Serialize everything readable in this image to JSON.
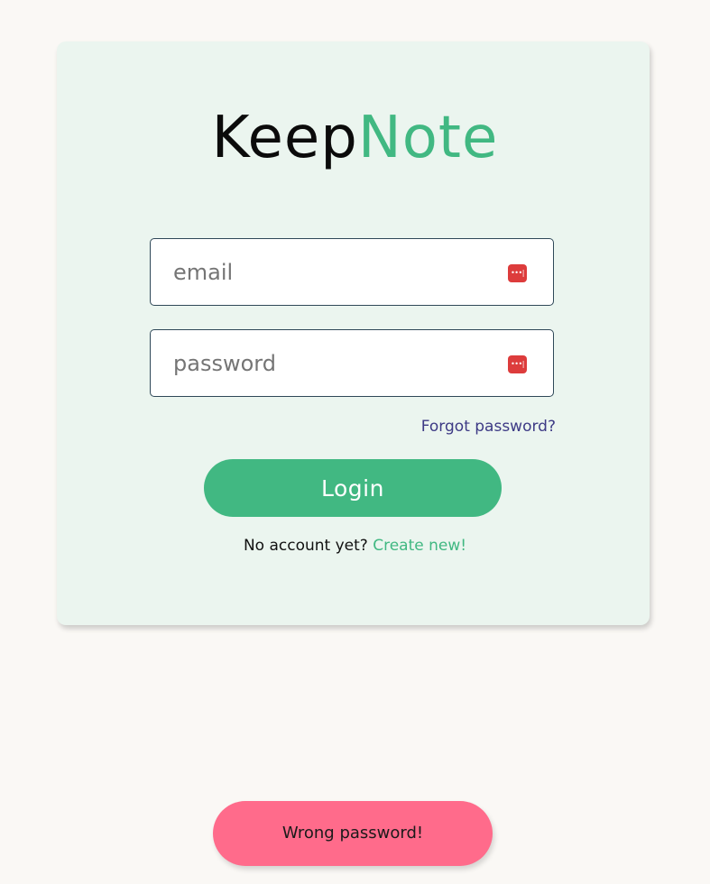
{
  "logo": {
    "part1": "Keep",
    "part2": "Note"
  },
  "form": {
    "email_placeholder": "email",
    "password_placeholder": "password",
    "forgot_label": "Forgot password?",
    "login_label": "Login",
    "no_account_text": "No account yet?",
    "create_label": "Create new!"
  },
  "icons": {
    "field_icon": "password-manager-icon",
    "field_icon_glyph": "•••|"
  },
  "toast": {
    "message": "Wrong password!"
  },
  "colors": {
    "brand_green": "#41b882",
    "card_bg": "#ebf5ef",
    "page_bg": "#faf8f5",
    "toast_bg": "#ff6b8b",
    "link_purple": "#3d3a85",
    "icon_red": "#dd3c3c"
  }
}
